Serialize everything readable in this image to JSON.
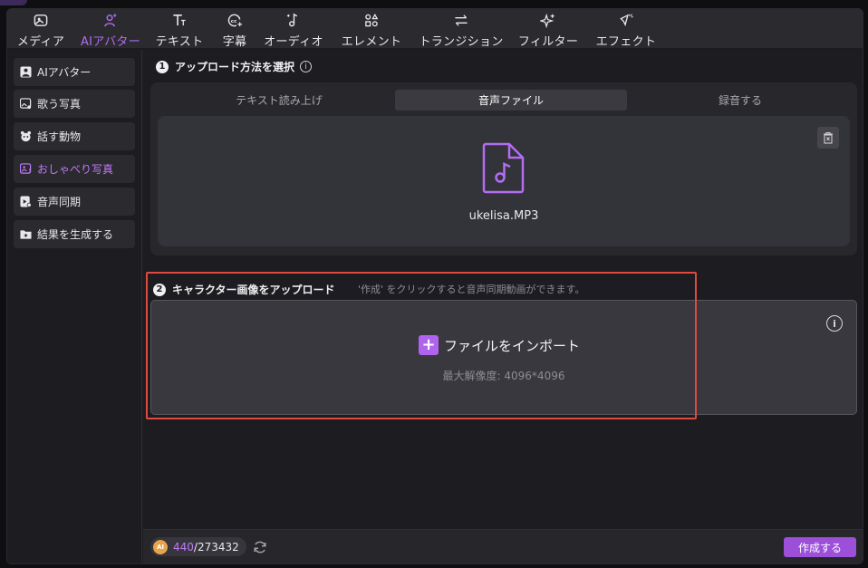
{
  "toolbar": {
    "tools": [
      {
        "label": "メディア",
        "icon": "media-icon"
      },
      {
        "label": "AIアバター",
        "icon": "ai-avatar-icon",
        "active": true
      },
      {
        "label": "テキスト",
        "icon": "text-icon"
      },
      {
        "label": "字幕",
        "icon": "subtitle-icon"
      },
      {
        "label": "オーディオ",
        "icon": "audio-icon"
      },
      {
        "label": "エレメント",
        "icon": "element-icon"
      },
      {
        "label": "トランジション",
        "icon": "transition-icon"
      },
      {
        "label": "フィルター",
        "icon": "filter-icon"
      },
      {
        "label": "エフェクト",
        "icon": "effect-icon"
      }
    ]
  },
  "sidebar": {
    "items": [
      {
        "label": "AIアバター",
        "icon": "avatar-icon"
      },
      {
        "label": "歌う写真",
        "icon": "singing-photo-icon"
      },
      {
        "label": "話す動物",
        "icon": "talking-animal-icon"
      },
      {
        "label": "おしゃべり写真",
        "icon": "talking-photo-icon",
        "active": true
      },
      {
        "label": "音声同期",
        "icon": "lip-sync-icon"
      },
      {
        "label": "結果を生成する",
        "icon": "generate-result-icon"
      }
    ]
  },
  "step1": {
    "number": "1",
    "title": "アップロード方法を選択",
    "info": "i",
    "tabs": [
      {
        "label": "テキスト読み上げ"
      },
      {
        "label": "音声ファイル",
        "active": true
      },
      {
        "label": "録音する"
      }
    ],
    "file_name": "ukelisa.MP3"
  },
  "step2": {
    "number": "2",
    "title": "キャラクター画像をアップロード",
    "hint": "'作成' をクリックすると音声同期動画ができます。",
    "import_label": "ファイルをインポート",
    "plus": "+",
    "info": "i",
    "max_resolution": "最大解像度: 4096*4096"
  },
  "bottom": {
    "coin_label": "AI",
    "credits_used": "440",
    "credits_total": "/273432",
    "create_label": "作成する"
  },
  "colors": {
    "accent": "#b36cf2",
    "highlight_outline": "#e04a3f",
    "create_button": "#9c4fd8"
  }
}
